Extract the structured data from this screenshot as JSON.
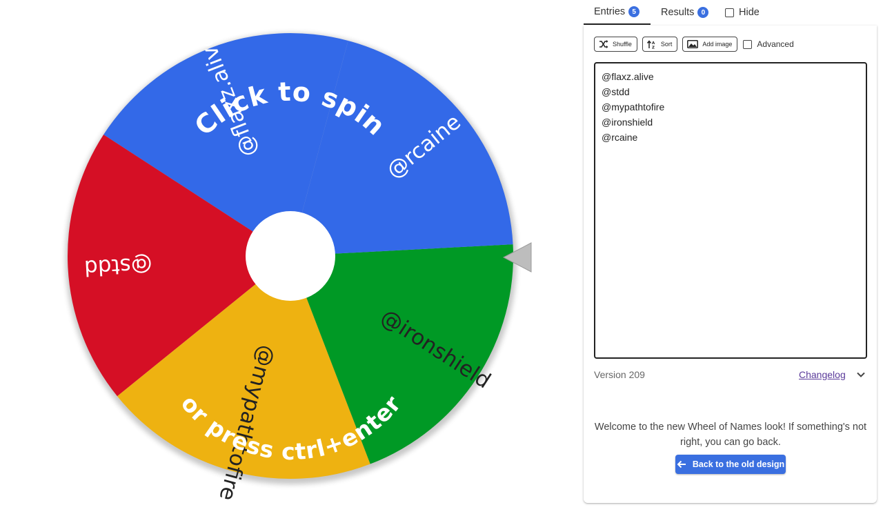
{
  "wheel": {
    "hint_line1": "Click to spin",
    "hint_line2": "or press ctrl+enter",
    "segments": [
      {
        "label": "@flaxz.alive",
        "color": "#3369e8"
      },
      {
        "label": "@stdd",
        "color": "#d50f25"
      },
      {
        "label": "@mypathtofire",
        "color": "#eeb211"
      },
      {
        "label": "@ironshield",
        "color": "#009925"
      },
      {
        "label": "@rcaine",
        "color": "#3369e8"
      }
    ]
  },
  "tabs": {
    "entries_label": "Entries",
    "entries_count": "5",
    "results_label": "Results",
    "results_count": "0",
    "hide_label": "Hide"
  },
  "toolbar": {
    "shuffle_label": "Shuffle",
    "sort_label": "Sort",
    "add_image_label": "Add image",
    "advanced_label": "Advanced"
  },
  "entries": [
    "@flaxz.alive",
    "@stdd",
    "@mypathtofire",
    "@ironshield",
    "@rcaine"
  ],
  "footer": {
    "version": "Version 209",
    "changelog": "Changelog"
  },
  "notice": {
    "text": "Welcome to the new Wheel of Names look! If something's not right, you can go back.",
    "button": "Back to the old design"
  },
  "colors": {
    "accent": "#3a6fe0"
  }
}
